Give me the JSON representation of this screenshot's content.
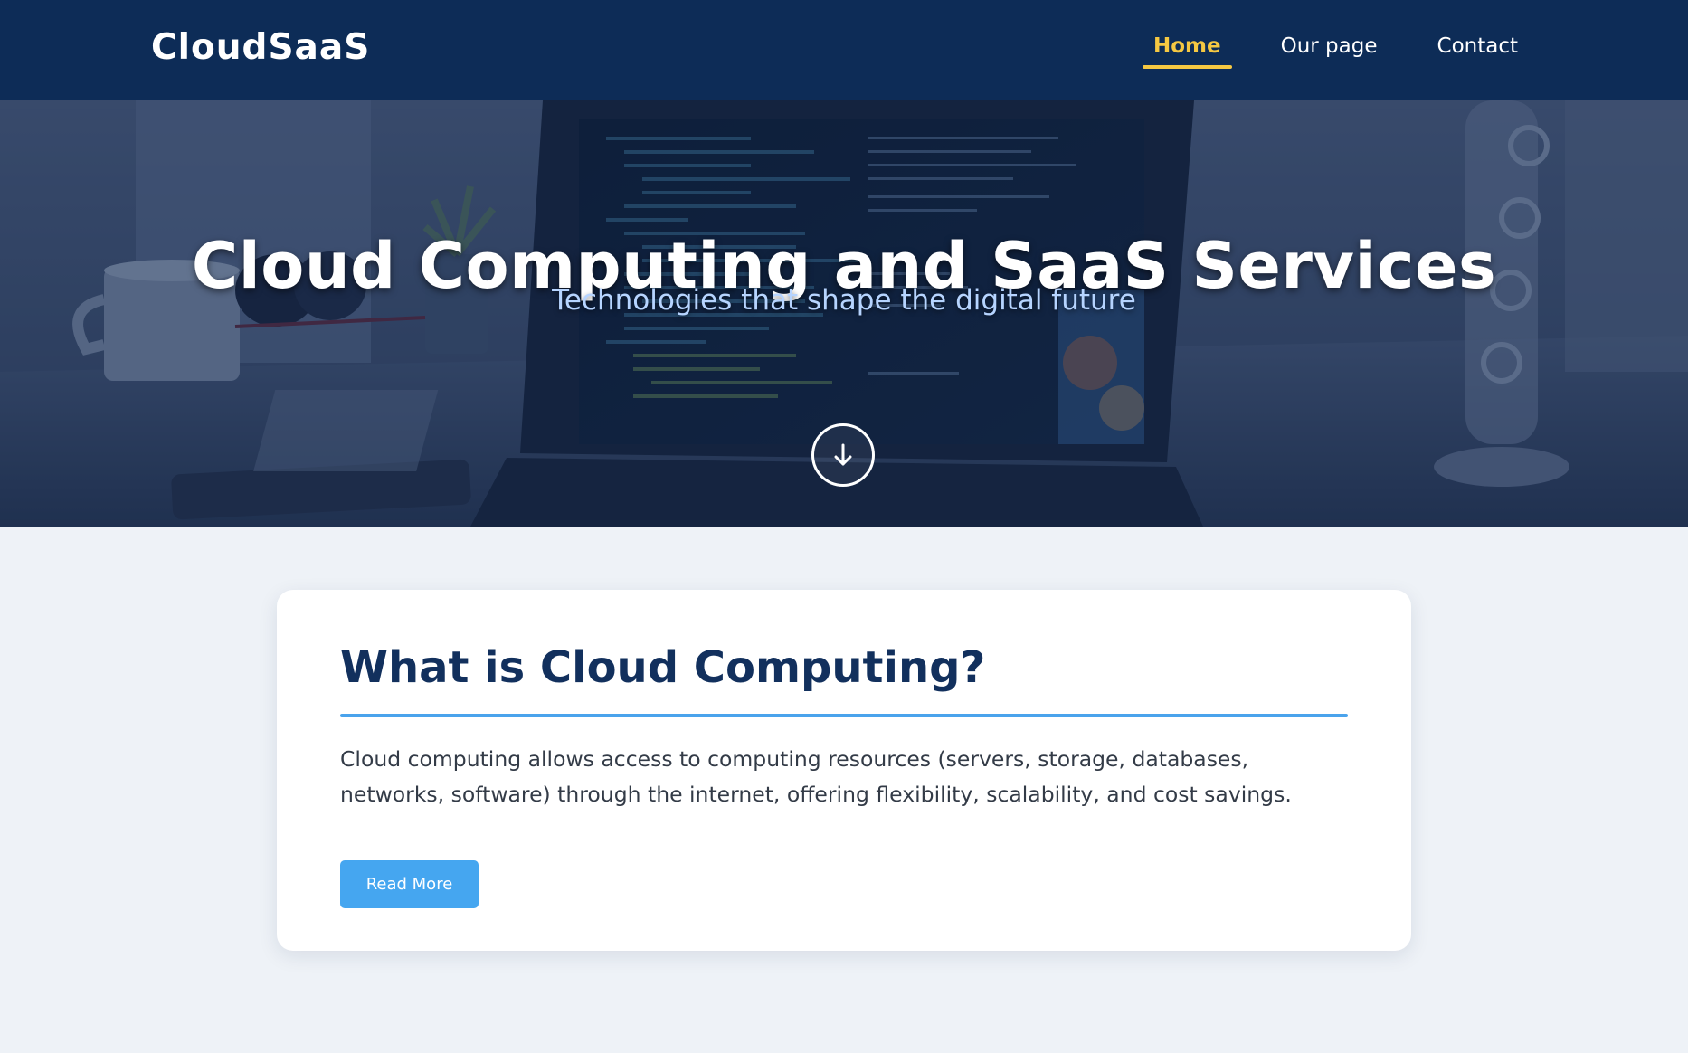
{
  "header": {
    "brand": "CloudSaaS",
    "nav": [
      {
        "label": "Home",
        "active": true
      },
      {
        "label": "Our page",
        "active": false
      },
      {
        "label": "Contact",
        "active": false
      }
    ],
    "accent_color": "#f5c842",
    "background_color": "#0d2c57"
  },
  "hero": {
    "title": "Cloud Computing and SaaS Services",
    "subtitle": "Technologies that shape the digital future",
    "scroll_icon": "arrow-down-icon"
  },
  "card": {
    "title": "What is Cloud Computing?",
    "text": "Cloud computing allows access to computing resources (servers, storage, databases, networks, software) through the internet, offering flexibility, scalability, and cost savings.",
    "button_label": "Read More",
    "accent_color": "#45a6f0"
  }
}
